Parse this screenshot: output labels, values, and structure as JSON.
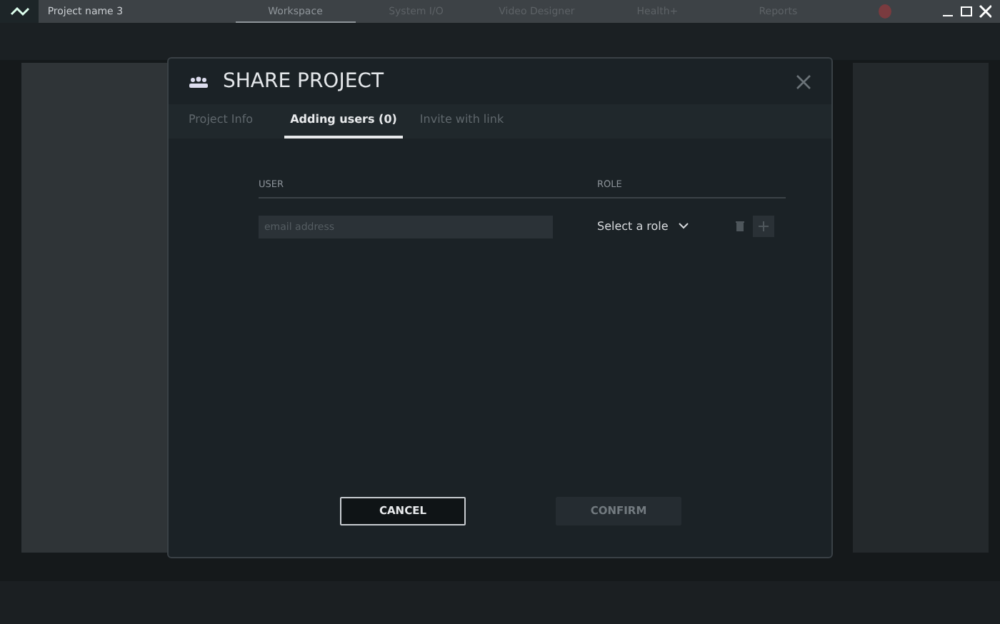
{
  "window": {
    "title": "Project name 3"
  },
  "app_tabs": [
    {
      "label": "Workspace",
      "selected": true
    },
    {
      "label": "System I/O",
      "selected": false
    },
    {
      "label": "Video Designer",
      "selected": false
    },
    {
      "label": "Health+",
      "selected": false
    },
    {
      "label": "Reports",
      "selected": false
    }
  ],
  "dialog": {
    "title": "SHARE PROJECT",
    "tabs": [
      {
        "label": "Project Info",
        "selected": false
      },
      {
        "label": "Adding users (0)",
        "selected": true
      },
      {
        "label": "Invite with link",
        "selected": false
      }
    ],
    "columns": [
      "USER",
      "ROLE"
    ],
    "rows": [
      {
        "email_placeholder": "email address",
        "role": "Select a role",
        "add_disabled": true
      }
    ],
    "buttons": [
      {
        "label": "CANCEL",
        "kind": "outline",
        "disabled": false
      },
      {
        "label": "CONFIRM",
        "kind": "primary",
        "disabled": true
      }
    ]
  }
}
